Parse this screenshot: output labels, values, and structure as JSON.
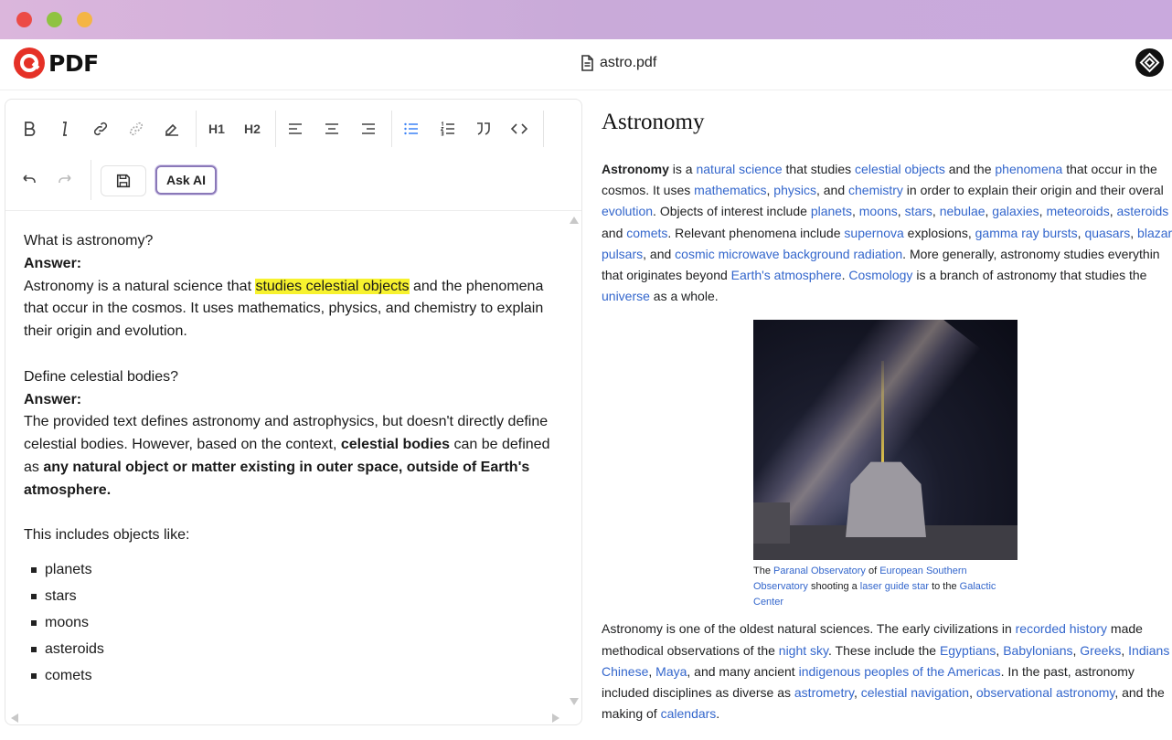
{
  "window": {
    "title": "astro.pdf"
  },
  "app": {
    "logo_text": "PDF",
    "brand_color": "#e53127"
  },
  "toolbar": {
    "bold": "bold-icon",
    "italic": "italic-icon",
    "link": "link-icon",
    "unlink": "unlink-icon",
    "eraser": "clear-format-icon",
    "h1": "H1",
    "h2": "H2",
    "align": [
      "align-left-icon",
      "align-center-icon",
      "align-right-icon"
    ],
    "lists": [
      "bullet-list-icon",
      "numbered-list-icon",
      "quote-icon",
      "code-icon"
    ],
    "undo": "undo-icon",
    "redo": "redo-icon",
    "save": "save-icon",
    "ask_ai_label": "Ask AI",
    "active_color": "#3b82f6"
  },
  "editor": {
    "q1": "What is astronomy?",
    "answer_label": "Answer:",
    "a1_pre": "Astronomy is a natural science that ",
    "a1_highlight": "studies celestial objects",
    "a1_post": " and the phenomena that occur in the cosmos. It uses mathematics, physics, and chemistry to explain their origin and evolution.",
    "q2": "Define celestial bodies?",
    "a2_pre": "The provided text defines astronomy and astrophysics, but doesn't directly define celestial bodies. However, based on the context, ",
    "a2_bold1": "celestial bodies",
    "a2_mid": " can be defined as ",
    "a2_bold2": "any natural object or matter existing in outer space, outside of Earth's atmosphere.",
    "includes": "This includes objects like:",
    "list": [
      "planets",
      "stars",
      "moons",
      "asteroids",
      "comets"
    ]
  },
  "article": {
    "title": "Astronomy",
    "caption": {
      "t1": "The ",
      "l1": "Paranal Observatory",
      "t2": " of ",
      "l2": "European Southern Observatory",
      "t3": " shooting a ",
      "l3": "laser guide star",
      "t4": " to the ",
      "l4": "Galactic Center"
    }
  }
}
